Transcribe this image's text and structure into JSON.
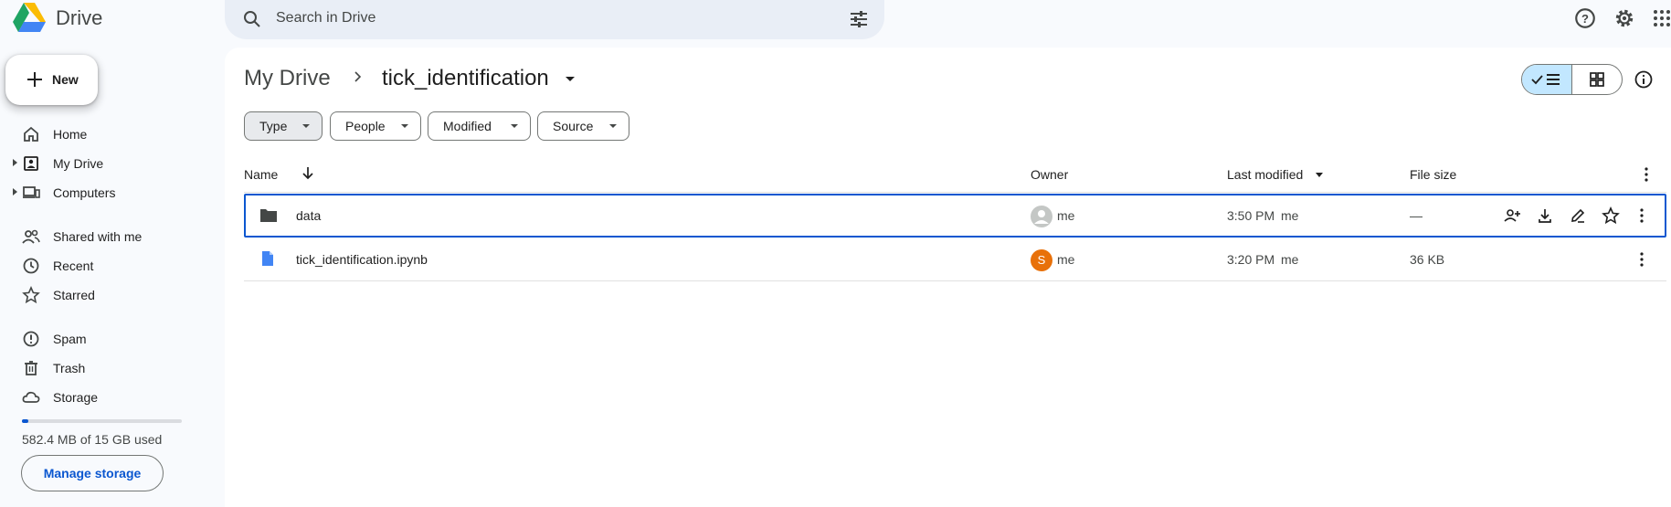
{
  "app": {
    "name": "Drive"
  },
  "search": {
    "placeholder": "Search in Drive"
  },
  "new_button": {
    "label": "New"
  },
  "sidebar": {
    "items": [
      {
        "label": "Home",
        "icon": "home-icon"
      },
      {
        "label": "My Drive",
        "icon": "my-drive-icon"
      },
      {
        "label": "Computers",
        "icon": "computers-icon"
      },
      {
        "label": "Shared with me",
        "icon": "shared-icon"
      },
      {
        "label": "Recent",
        "icon": "clock-icon"
      },
      {
        "label": "Starred",
        "icon": "star-icon"
      },
      {
        "label": "Spam",
        "icon": "spam-icon"
      },
      {
        "label": "Trash",
        "icon": "trash-icon"
      },
      {
        "label": "Storage",
        "icon": "cloud-icon"
      }
    ],
    "storage_used_text": "582.4 MB of 15 GB used",
    "storage_fraction": 0.0388,
    "manage_storage_label": "Manage storage"
  },
  "breadcrumb": {
    "root": "My Drive",
    "current": "tick_identification"
  },
  "filters": [
    "Type",
    "People",
    "Modified",
    "Source"
  ],
  "table": {
    "headers": {
      "name": "Name",
      "owner": "Owner",
      "last_modified": "Last modified",
      "file_size": "File size"
    },
    "rows": [
      {
        "name": "data",
        "type": "folder",
        "owner": "me",
        "avatar": "",
        "modified": "3:50 PM",
        "modified_by": "me",
        "size": "—"
      },
      {
        "name": "tick_identification.ipynb",
        "type": "file",
        "owner": "me",
        "avatar": "S",
        "modified": "3:20 PM",
        "modified_by": "me",
        "size": "36 KB"
      }
    ]
  },
  "colors": {
    "accent": "#0b57d0",
    "selected_view": "#c2e7ff",
    "sidebar_bg": "#f8fafd"
  }
}
